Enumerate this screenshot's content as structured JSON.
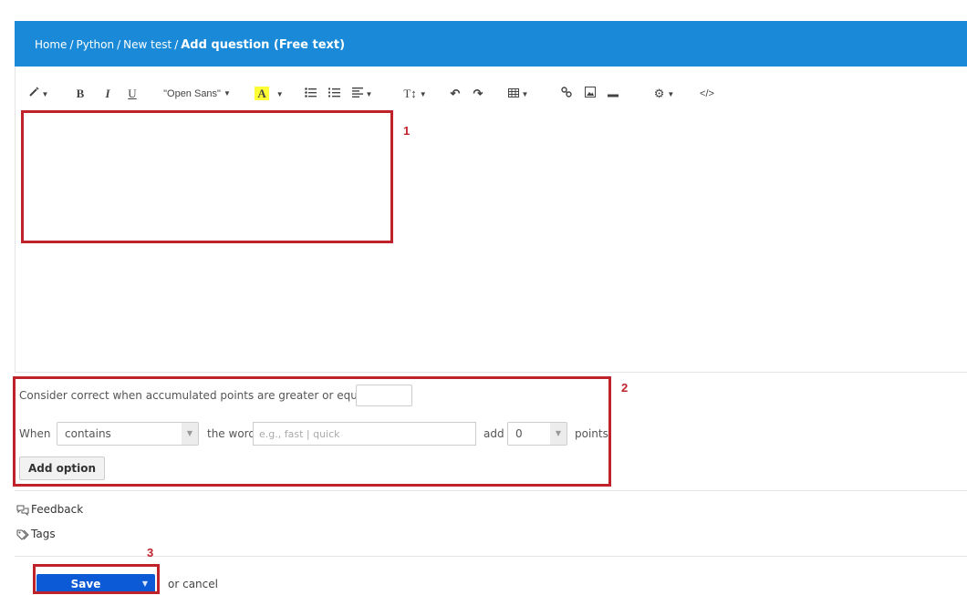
{
  "breadcrumb": {
    "items": [
      "Home",
      "Python",
      "New test"
    ],
    "separator": "/",
    "current": "Add question (Free text)"
  },
  "toolbar": {
    "font_name": "\"Open Sans\"",
    "bold": "B",
    "italic": "I",
    "underline": "U",
    "highlight": "A",
    "font_size": "T↕",
    "code": "</>"
  },
  "annotations": {
    "box1": "1",
    "box2": "2",
    "box3": "3"
  },
  "options": {
    "threshold_label": "Consider correct when accumulated points are greater or equal to",
    "when_label": "When",
    "condition": "contains",
    "the_word_label": "the word",
    "word_placeholder": "e.g., fast | quick",
    "add_label": "add",
    "points_value": "0",
    "points_label": "points",
    "add_option_button": "Add option"
  },
  "links": {
    "feedback": "Feedback",
    "tags": "Tags"
  },
  "footer": {
    "save_button": "Save",
    "or_cancel": "or cancel"
  },
  "colors": {
    "header": "#1a8ad8",
    "save": "#0d5ad6",
    "annotation": "#c0222b",
    "highlight": "#ffff33"
  }
}
